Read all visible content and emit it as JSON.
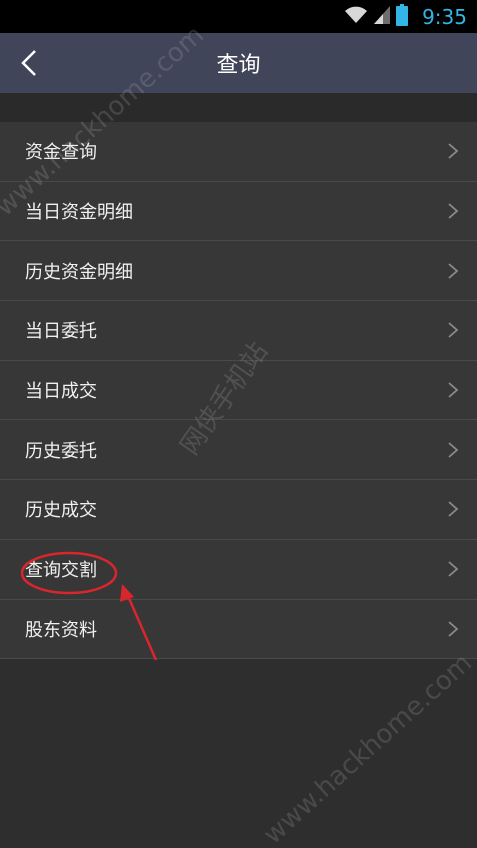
{
  "status_bar": {
    "time": "9:35",
    "icons": [
      "wifi-icon",
      "signal-icon",
      "battery-icon"
    ]
  },
  "header": {
    "title": "查询",
    "back_icon": "chevron-left-icon"
  },
  "menu": {
    "items": [
      {
        "label": "资金查询"
      },
      {
        "label": "当日资金明细"
      },
      {
        "label": "历史资金明细"
      },
      {
        "label": "当日委托"
      },
      {
        "label": "当日成交"
      },
      {
        "label": "历史委托"
      },
      {
        "label": "历史成交"
      },
      {
        "label": "查询交割"
      },
      {
        "label": "股东资料"
      }
    ]
  },
  "watermarks": {
    "top": "www.hackhome.com",
    "middle": "网侠手机站",
    "bottom": "www.hackhome.com"
  },
  "colors": {
    "header_bg": "#414559",
    "list_bg": "#373737",
    "page_bg": "#2e2e2e",
    "status_time": "#33b5e5",
    "annotation": "#d9262c"
  }
}
